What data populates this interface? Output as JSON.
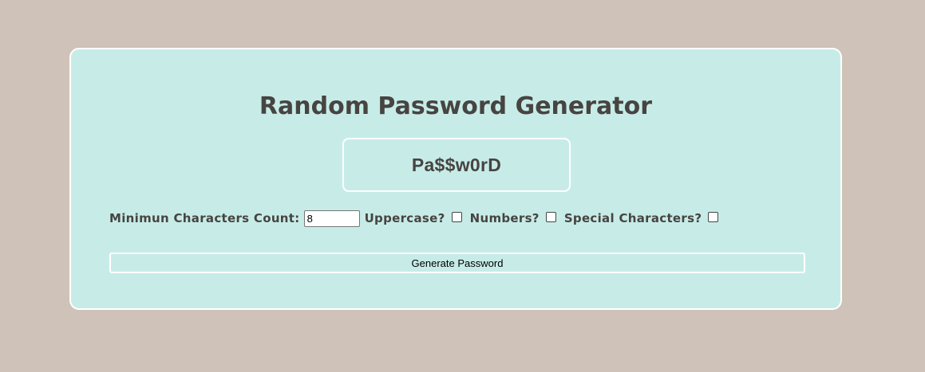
{
  "app": {
    "title": "Random Password Generator"
  },
  "password": {
    "display_value": "Pa$$w0rD"
  },
  "options": {
    "min_count_label": "Minimun Characters Count:",
    "min_count_value": "8",
    "uppercase_label": "Uppercase?",
    "uppercase_checked": false,
    "numbers_label": "Numbers?",
    "numbers_checked": false,
    "special_label": "Special Characters?",
    "special_checked": false
  },
  "actions": {
    "generate_label": "Generate Password"
  },
  "colors": {
    "background": "#cfc2b9",
    "card": "#c7ece8",
    "text": "#474441",
    "border": "#ffffff"
  }
}
